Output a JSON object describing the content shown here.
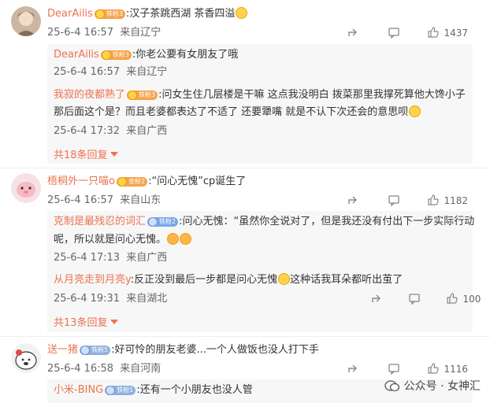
{
  "comments": [
    {
      "user": "DearAilis",
      "badge": "铁粉3",
      "text": ":汉子茶跳西湖 茶香四溢",
      "time": "25-6-4 16:57",
      "location": "来自辽宁",
      "likes": "1437",
      "replies": [
        {
          "user": "DearAilis",
          "badge": "铁粉3",
          "text": ":你老公要有女朋友了哦",
          "time": "25-6-4 16:57",
          "location": "来自辽宁"
        },
        {
          "user": "我寂的夜都熟了",
          "badge": "铁粉3",
          "text1": ":问女生住几层楼是干嘛 这点我没明白 拨菜那里我撑死算他大馋小子",
          "text2": "那后面这个是？而且老婆都表达了不适了 还要犟嘴 就是不认下次还会的意思呗",
          "time": "25-6-4 17:32",
          "location": "来自广西"
        }
      ],
      "more": "共18条回复"
    },
    {
      "user": "梧桐外一只喵o",
      "badge": "金粉2",
      "text": ":“问心无愧”cp诞生了",
      "time": "25-6-4 16:57",
      "location": "来自山东",
      "likes": "1182",
      "replies": [
        {
          "user": "克制是最残忍的词汇",
          "badge": "铁粉2",
          "text1": ":问心无愧：“虽然你全说对了，但是我还没有付出下一步实际行动",
          "text2": "呢，所以就是问心无愧。",
          "time": "25-6-4 17:13",
          "location": "来自广西"
        },
        {
          "user": "从月亮走到月亮y",
          "text": ":反正没到最后一步都是问心无愧",
          "text_b": "这种话我耳朵都听出茧了",
          "time": "25-6-4 19:31",
          "location": "来自湖北",
          "likes": "100"
        }
      ],
      "more": "共13条回复"
    },
    {
      "user": "送一猪",
      "badge": "铁粉5",
      "text": ":好可怜的朋友老婆...一个人做饭也没人打下手",
      "time": "25-6-4 16:58",
      "location": "来自河南",
      "likes": "1116",
      "replies": [
        {
          "user": "小米-BING",
          "badge": "铁粉1",
          "text": ":还有一个小朋友也没人管"
        }
      ]
    }
  ],
  "watermark": "公众号 · 女神汇",
  "colors": {
    "username": "#eb7350",
    "meta": "#666666",
    "reply_bg": "#f7f7f7"
  }
}
